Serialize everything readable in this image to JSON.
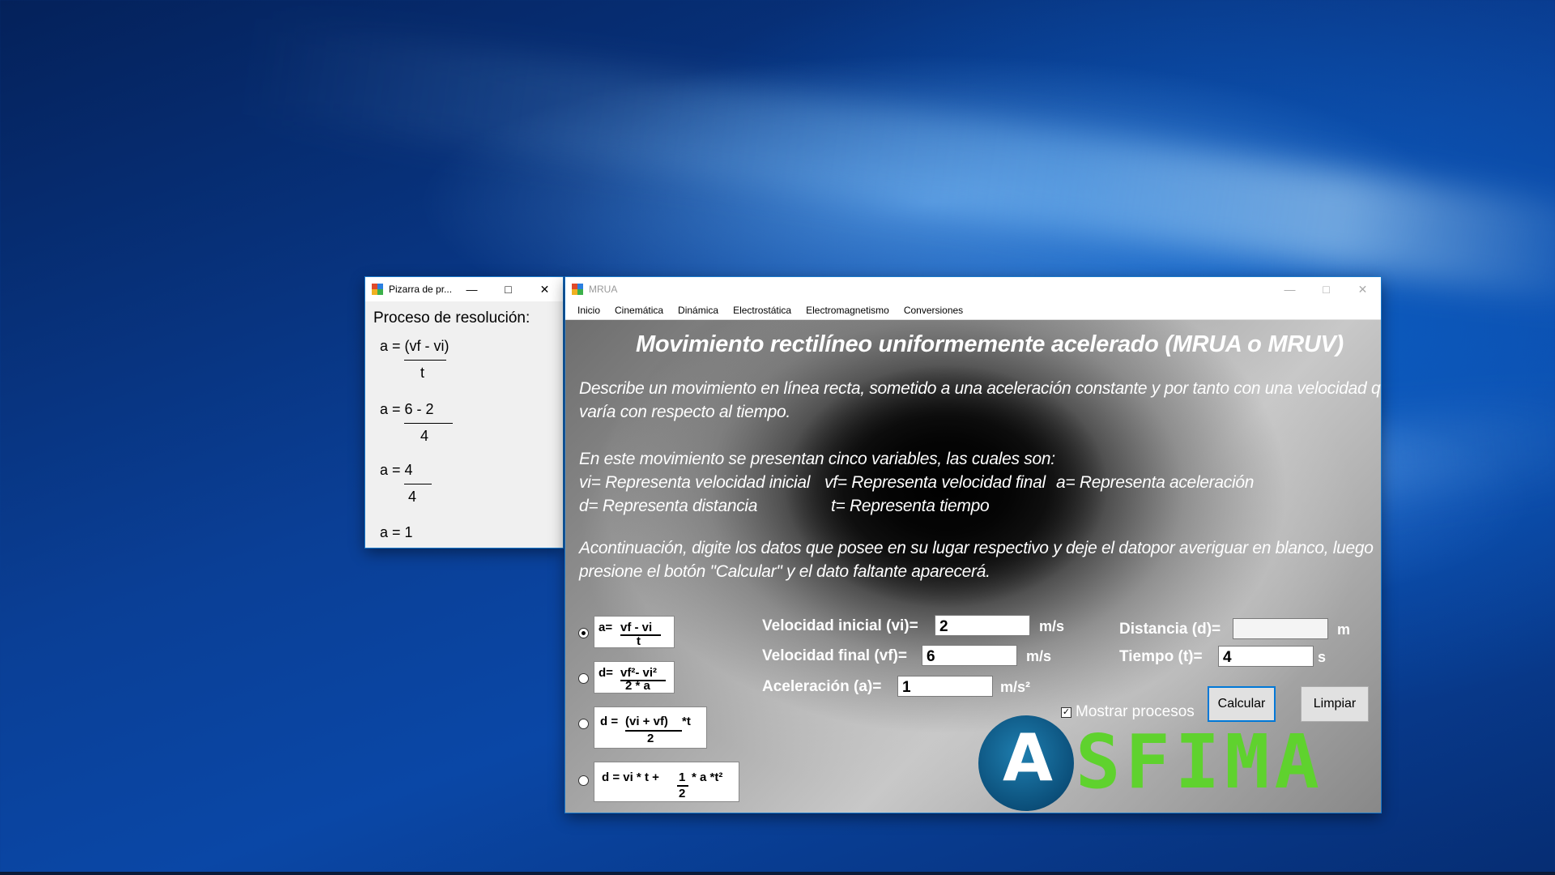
{
  "pizarra": {
    "title": "Pizarra de pr...",
    "heading": "Proceso de resolución:",
    "steps": [
      {
        "num": "a = (vf - vi)",
        "den": "t"
      },
      {
        "num": "a = 6 - 2",
        "den": "4"
      },
      {
        "num": "a = 4",
        "den": "4"
      },
      {
        "num": "a = 1",
        "den": ""
      }
    ]
  },
  "mrua": {
    "title": "MRUA",
    "menu": [
      "Inicio",
      "Cinemática",
      "Dinámica",
      "Electrostática",
      "Electromagnetismo",
      "Conversiones"
    ],
    "heading": "Movimiento rectilíneo uniformemente acelerado (MRUA o MRUV)",
    "description_1": "Describe un movimiento en línea recta, sometido a una aceleración constante y por tanto con una velocidad que",
    "description_2": "varía con respecto al tiempo.",
    "variables_intro": "En este movimiento se presentan cinco variables, las cuales son:",
    "var_vi": "vi= Representa velocidad inicial",
    "var_vf": "vf= Representa velocidad final",
    "var_a": "a= Representa aceleración",
    "var_d": "d= Representa distancia",
    "var_t": "t= Representa tiempo",
    "instructions_1": "Acontinuación, digite los datos que posee en su lugar respectivo y  deje el datopor averiguar en blanco, luego",
    "instructions_2": "presione  el botón \"Calcular\" y el dato faltante aparecerá.",
    "formulas": {
      "f1_left": "a=",
      "f1_num": "vf - vi",
      "f1_den": "t",
      "f2_left": "d=",
      "f2_num": "vf²- vi²",
      "f2_den": "2 * a",
      "f3_left": "d =",
      "f3_num": "(vi + vf)",
      "f3_right": "*t",
      "f3_den": "2",
      "f4_left": "d = vi * t +",
      "f4_num": "1",
      "f4_den": "2",
      "f4_right": "* a *t²"
    },
    "fields": {
      "vi_label": "Velocidad inicial (vi)=",
      "vi_value": "2",
      "vi_unit": "m/s",
      "vf_label": "Velocidad final (vf)=",
      "vf_value": "6",
      "vf_unit": "m/s",
      "a_label": "Aceleración (a)=",
      "a_value": "1",
      "a_unit": "m/s²",
      "d_label": "Distancia (d)=",
      "d_value": "",
      "d_unit": "m",
      "t_label": "Tiempo (t)=",
      "t_value": "4",
      "t_unit": "s"
    },
    "mostrar_label": "Mostrar procesos",
    "mostrar_checked": true,
    "calcular_label": "Calcular",
    "limpiar_label": "Limpiar",
    "logo": {
      "letter": "A",
      "text": "SFIMA",
      "color": "#5fd22e"
    }
  }
}
